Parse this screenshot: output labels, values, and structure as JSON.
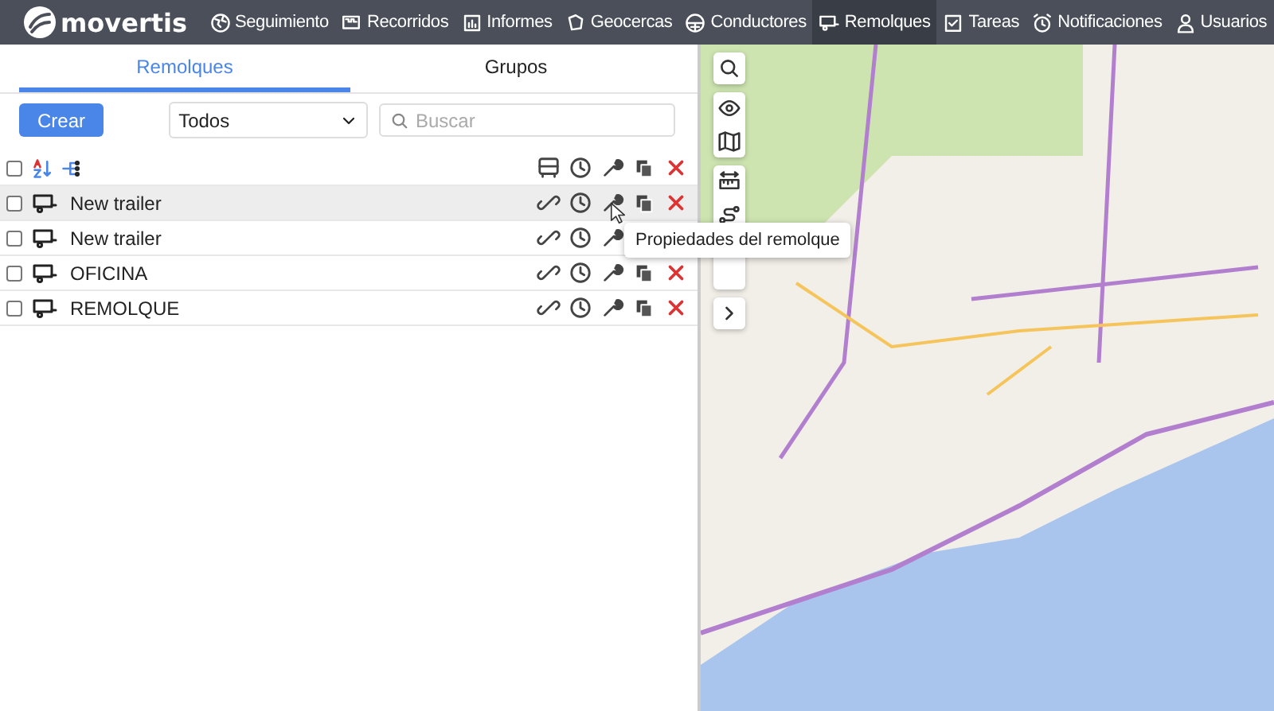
{
  "navbar": {
    "logo": "movertis",
    "items": [
      {
        "label": "Seguimiento",
        "selected": false
      },
      {
        "label": "Recorridos",
        "selected": false
      },
      {
        "label": "Informes",
        "selected": false
      },
      {
        "label": "Geocercas",
        "selected": false
      },
      {
        "label": "Conductores",
        "selected": false
      },
      {
        "label": "Remolques",
        "selected": true
      },
      {
        "label": "Tareas",
        "selected": false
      },
      {
        "label": "Notificaciones",
        "selected": false
      },
      {
        "label": "Usuarios",
        "selected": false
      }
    ]
  },
  "tabs": [
    {
      "label": "Remolques",
      "selected": true
    },
    {
      "label": "Grupos",
      "selected": false
    }
  ],
  "toolbar": {
    "create_button": "Crear",
    "filter": {
      "value": "Todos"
    },
    "search": {
      "placeholder": "Buscar"
    }
  },
  "list_header": {
    "checked": false
  },
  "rows": [
    {
      "name": "New trailer",
      "checked": false,
      "highlighted": true
    },
    {
      "name": "New trailer",
      "checked": false,
      "highlighted": false
    },
    {
      "name": "OFICINA",
      "checked": false,
      "highlighted": false
    },
    {
      "name": "REMOLQUE",
      "checked": false,
      "highlighted": false
    }
  ],
  "tooltip": "Propiedades del remolque"
}
